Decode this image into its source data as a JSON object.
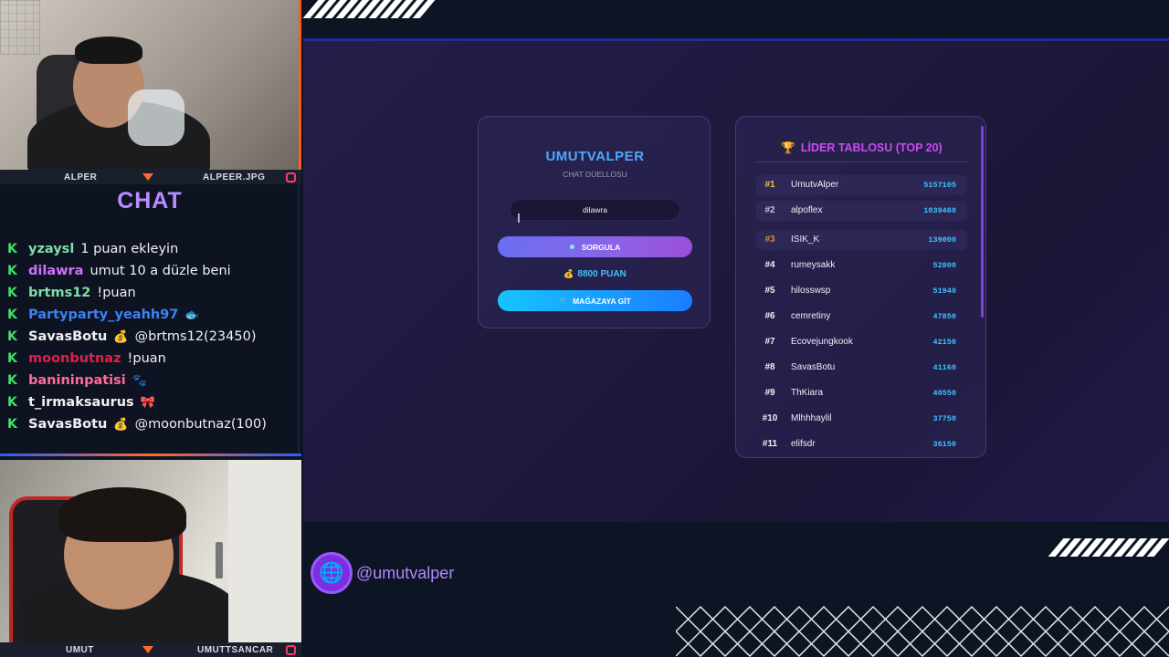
{
  "cams": {
    "top": {
      "left_label": "ALPER",
      "right_label": "ALPEER.JPG"
    },
    "bottom": {
      "left_label": "UMUT",
      "right_label": "UMUTTSANCAR"
    }
  },
  "chat": {
    "title": "CHAT",
    "messages": [
      {
        "user": "yzaysl",
        "user_color": "#7ee0a8",
        "emote": "",
        "text": "1 puan ekleyin"
      },
      {
        "user": "dilawra",
        "user_color": "#d072ff",
        "emote": "",
        "text": "umut 10 a düzle beni"
      },
      {
        "user": "brtms12",
        "user_color": "#7ee0a8",
        "emote": "",
        "text": "!puan"
      },
      {
        "user": "Partyparty_yeahh97",
        "user_color": "#3b82f6",
        "emote": "🐟",
        "text": ""
      },
      {
        "user": "SavasBotu",
        "user_color": "#f1f1f4",
        "emote": "💰",
        "text": "@brtms12(23450)"
      },
      {
        "user": "moonbutnaz",
        "user_color": "#e0204a",
        "emote": "",
        "text": "!puan"
      },
      {
        "user": "banininpatisi",
        "user_color": "#ff6b9a",
        "emote": "🐾",
        "text": ""
      },
      {
        "user": "t_irmaksaurus",
        "user_color": "#f1f1f4",
        "emote": "🎀",
        "text": ""
      },
      {
        "user": "SavasBotu",
        "user_color": "#f1f1f4",
        "emote": "💰",
        "text": "@moonbutnaz(100)"
      }
    ]
  },
  "query_card": {
    "brand": "UMUTVALPER",
    "subtitle": "CHAT DÜELLOSU",
    "input_value": "dilawra",
    "query_button": "SORGULA",
    "points_label": "8800 PUAN",
    "store_button": "MAĞAZAYA GİT"
  },
  "leaderboard": {
    "title": "LİDER TABLOSU (TOP 20)",
    "rows": [
      {
        "rank": "#1",
        "name": "UmutvAlper",
        "score": "5157105",
        "rank_color": "#f3c13a"
      },
      {
        "rank": "#2",
        "name": "alpoflex",
        "score": "1039460",
        "rank_color": "#c8c8d8"
      },
      {
        "rank": "#3",
        "name": "ISIK_K",
        "score": "139000",
        "rank_color": "#d98a3a"
      },
      {
        "rank": "#4",
        "name": "rumeysakk",
        "score": "52800",
        "rank_color": "#f0f0f5"
      },
      {
        "rank": "#5",
        "name": "hilosswsp",
        "score": "51940",
        "rank_color": "#f0f0f5"
      },
      {
        "rank": "#6",
        "name": "cemretiny",
        "score": "47850",
        "rank_color": "#f0f0f5"
      },
      {
        "rank": "#7",
        "name": "Ecovejungkook",
        "score": "42150",
        "rank_color": "#f0f0f5"
      },
      {
        "rank": "#8",
        "name": "SavasBotu",
        "score": "41160",
        "rank_color": "#f0f0f5"
      },
      {
        "rank": "#9",
        "name": "ThKiara",
        "score": "40550",
        "rank_color": "#f0f0f5"
      },
      {
        "rank": "#10",
        "name": "Mlhhhaylil",
        "score": "37750",
        "rank_color": "#f0f0f5"
      },
      {
        "rank": "#11",
        "name": "elifsdr",
        "score": "36150",
        "rank_color": "#f0f0f5"
      }
    ]
  },
  "footer": {
    "handle": "@umutvalper",
    "globe_icon": "globe-icon"
  }
}
